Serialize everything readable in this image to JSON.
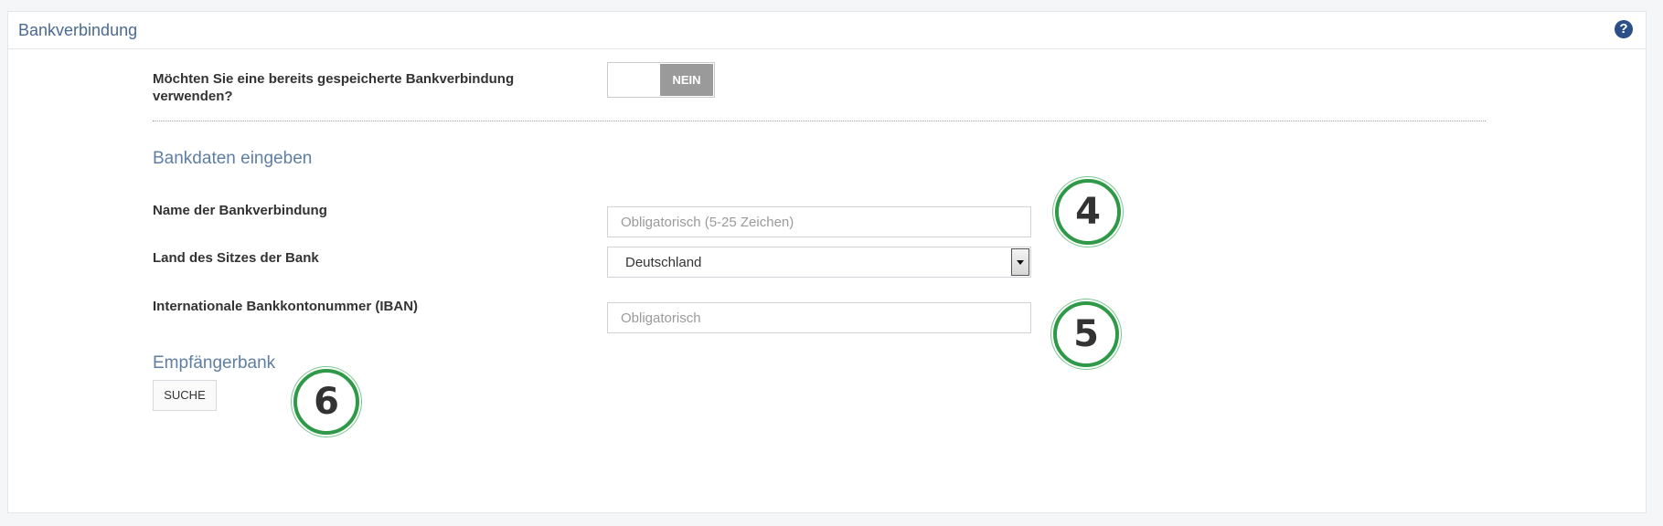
{
  "panel": {
    "title": "Bankverbindung",
    "help_icon": "question-circle-icon",
    "help_glyph": "?"
  },
  "saved_account": {
    "question": "Möchten Sie eine bereits gespeicherte Bankverbindung verwenden?",
    "toggle_value": "NEIN"
  },
  "bank_data": {
    "section_title": "Bankdaten eingeben",
    "name_label": "Name der Bankverbindung",
    "name_placeholder": "Obligatorisch (5-25 Zeichen)",
    "name_value": "",
    "country_label": "Land des Sitzes der Bank",
    "country_value": "Deutschland",
    "iban_label": "Internationale Bankkontonummer (IBAN)",
    "iban_placeholder": "Obligatorisch",
    "iban_value": ""
  },
  "recipient_bank": {
    "section_title": "Empfängerbank",
    "search_button": "SUCHE"
  },
  "annotations": {
    "badge_4": "4",
    "badge_5": "5",
    "badge_6": "6"
  },
  "colors": {
    "accent": "#4a6a96",
    "badge_ring": "#2e9a47",
    "toggle_off": "#9a9a9a"
  }
}
